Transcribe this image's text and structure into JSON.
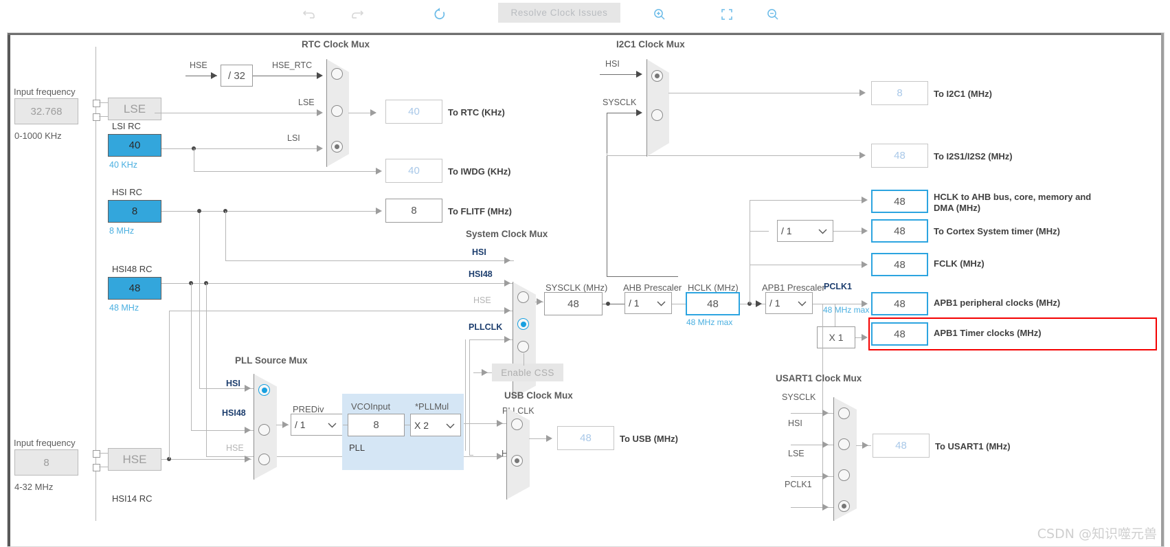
{
  "toolbar": {
    "undo_icon": "undo-arrow-icon",
    "redo_icon": "redo-arrow-icon",
    "reset_icon": "reset-circular-arrow-icon",
    "resolve_label": "Resolve Clock Issues",
    "zoom_in_icon": "zoom-in-icon",
    "fit_icon": "fit-to-screen-icon",
    "zoom_out_icon": "zoom-out-icon"
  },
  "inputs": {
    "lse": {
      "caption": "Input frequency",
      "value": "32.768",
      "range": "0-1000 KHz",
      "osc_label": "LSE"
    },
    "hse": {
      "caption": "Input frequency",
      "value": "8",
      "range": "4-32 MHz",
      "osc_label": "HSE"
    }
  },
  "oscillators": {
    "lsi": {
      "name": "LSI RC",
      "value": "40",
      "unit": "40 KHz"
    },
    "hsi": {
      "name": "HSI RC",
      "value": "8",
      "unit": "8 MHz"
    },
    "hsi48": {
      "name": "HSI48 RC",
      "value": "48",
      "unit": "48 MHz"
    },
    "hsi14": {
      "name": "HSI14 RC"
    }
  },
  "rtc_mux": {
    "title": "RTC Clock Mux",
    "hse_in_label": "HSE",
    "divider": "/ 32",
    "inputs": [
      "HSE_RTC",
      "LSE",
      "LSI"
    ],
    "selected_index": 2
  },
  "rtc_outputs": {
    "to_rtc": {
      "value": "40",
      "label": "To RTC (KHz)"
    },
    "to_iwdg": {
      "value": "40",
      "label": "To IWDG (KHz)"
    }
  },
  "flitf": {
    "value": "8",
    "label": "To FLITF (MHz)"
  },
  "i2c1_mux": {
    "title": "I2C1 Clock Mux",
    "inputs": [
      "HSI",
      "SYSCLK"
    ],
    "selected_index": 0
  },
  "i2c_outputs": {
    "to_i2c1": {
      "value": "8",
      "label": "To I2C1 (MHz)"
    },
    "to_i2s": {
      "value": "48",
      "label": "To I2S1/I2S2 (MHz)"
    }
  },
  "system_clock_mux": {
    "title": "System Clock Mux",
    "inputs": [
      "HSI",
      "HSI48",
      "HSE",
      "PLLCLK"
    ],
    "selected_index": 1,
    "disabled_inputs": [
      "HSE"
    ]
  },
  "sysclk": {
    "label": "SYSCLK (MHz)",
    "value": "48"
  },
  "ahb_prescaler": {
    "label": "AHB Prescaler",
    "value": "/ 1"
  },
  "hclk": {
    "label": "HCLK (MHz)",
    "value": "48",
    "max": "48 MHz max"
  },
  "cortex_prescaler": {
    "value": "/ 1"
  },
  "apb1_prescaler": {
    "label": "APB1 Prescaler",
    "value": "/ 1"
  },
  "pclk1": {
    "label": "PCLK1",
    "max": "48 MHz max"
  },
  "apb1_timer_mult": {
    "value": "X 1"
  },
  "outputs": [
    {
      "value": "48",
      "label": "HCLK to AHB bus, core, memory and DMA (MHz)",
      "style": "active"
    },
    {
      "value": "48",
      "label": "To Cortex System timer (MHz)",
      "style": "active"
    },
    {
      "value": "48",
      "label": "FCLK (MHz)",
      "style": "active"
    },
    {
      "value": "48",
      "label": "APB1 peripheral clocks (MHz)",
      "style": "active"
    },
    {
      "value": "48",
      "label": "APB1 Timer clocks (MHz)",
      "style": "active-highlighted"
    }
  ],
  "pll_source_mux": {
    "title": "PLL Source Mux",
    "inputs": [
      "HSI",
      "HSI48",
      "HSE"
    ],
    "selected_index": 0,
    "disabled_inputs": [
      "HSE"
    ]
  },
  "pll": {
    "group_label": "PLL",
    "prediv_label": "PREDiv",
    "prediv_value": "/ 1",
    "vcoinput_label": "VCOInput",
    "vcoinput_value": "8",
    "pllmul_label": "*PLLMul",
    "pllmul_value": "X 2"
  },
  "enable_css": {
    "label": "Enable CSS"
  },
  "usb_mux": {
    "title": "USB Clock Mux",
    "inputs": [
      "PLLCLK",
      "HSI48"
    ],
    "selected_index": 1,
    "output": {
      "value": "48",
      "label": "To USB (MHz)"
    }
  },
  "usart1_mux": {
    "title": "USART1 Clock Mux",
    "inputs": [
      "SYSCLK",
      "HSI",
      "LSE",
      "PCLK1"
    ],
    "selected_index": 3,
    "output": {
      "value": "48",
      "label": "To USART1 (MHz)"
    }
  },
  "watermark": {
    "text": "CSDN @知识噬元兽"
  },
  "colors": {
    "accent_blue": "#2ca4e0",
    "osc_fill": "#33a6dc",
    "highlight_red": "#f40000",
    "pll_group": "#d5e6f5"
  }
}
